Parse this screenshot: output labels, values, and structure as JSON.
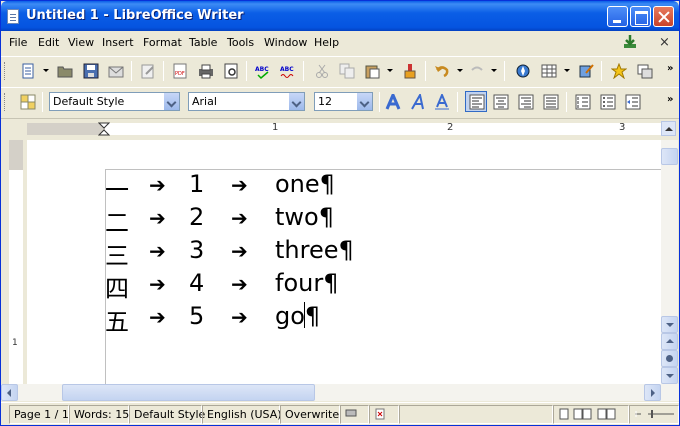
{
  "window": {
    "title": "Untitled 1 - LibreOffice Writer"
  },
  "menubar": {
    "items": [
      "File",
      "Edit",
      "View",
      "Insert",
      "Format",
      "Table",
      "Tools",
      "Window",
      "Help"
    ],
    "close_glyph": "×"
  },
  "toolbar_format": {
    "paragraph_style": "Default Style",
    "font_name": "Arial",
    "font_size": "12"
  },
  "ruler": {
    "labels": [
      "1",
      "2",
      "3"
    ]
  },
  "document": {
    "lines": [
      {
        "kanji": "一",
        "arrow1": "➔",
        "number": "1",
        "arrow2": "➔",
        "word": "one¶"
      },
      {
        "kanji": "二",
        "arrow1": "➔",
        "number": "2",
        "arrow2": "➔",
        "word": "two¶"
      },
      {
        "kanji": "三",
        "arrow1": "➔",
        "number": "3",
        "arrow2": "➔",
        "word": "three¶"
      },
      {
        "kanji": "四",
        "arrow1": "➔",
        "number": "4",
        "arrow2": "➔",
        "word": "four¶"
      },
      {
        "kanji": "五",
        "arrow1": "➔",
        "number": "5",
        "arrow2": "➔",
        "word_before_caret": "go",
        "word_after_caret": "¶"
      }
    ]
  },
  "statusbar": {
    "page": "Page 1 / 1",
    "words": "Words: 15",
    "style": "Default Style",
    "language": "English (USA)",
    "mode": "Overwrite"
  },
  "colors": {
    "titlebar": "#0554e0",
    "chrome": "#ece9d8",
    "accent": "#316ac5"
  }
}
